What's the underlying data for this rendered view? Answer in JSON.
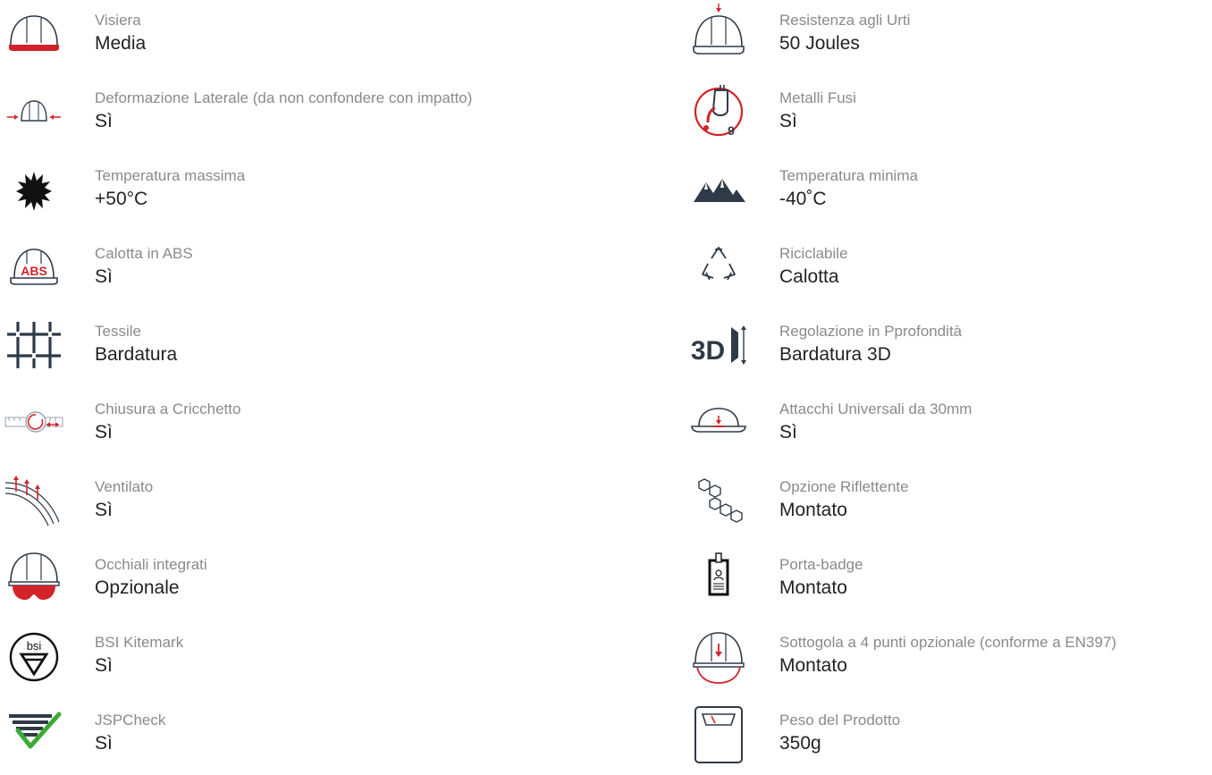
{
  "colors": {
    "accent_red": "#d2232a",
    "icon_dark": "#2f3a48",
    "label_gray": "#8a8a8a",
    "value_dark": "#222222",
    "check_green": "#3aa935"
  },
  "left": [
    {
      "label": "Visiera",
      "value": "Media",
      "icon": "visor-helmet-icon"
    },
    {
      "label": "Deformazione Laterale (da non confondere con impatto)",
      "value": "Sì",
      "icon": "lateral-deformation-icon"
    },
    {
      "label": "Temperatura massima",
      "value": "+50°C",
      "icon": "sun-icon"
    },
    {
      "label": "Calotta in ABS",
      "value": "Sì",
      "icon": "abs-helmet-icon",
      "icon_text": "ABS"
    },
    {
      "label": "Tessile",
      "value": "Bardatura",
      "icon": "textile-grid-icon"
    },
    {
      "label": "Chiusura a Cricchetto",
      "value": "Sì",
      "icon": "ratchet-icon"
    },
    {
      "label": "Ventilato",
      "value": "Sì",
      "icon": "ventilation-icon"
    },
    {
      "label": "Occhiali integrati",
      "value": "Opzionale",
      "icon": "goggles-helmet-icon"
    },
    {
      "label": "BSI Kitemark",
      "value": "Sì",
      "icon": "bsi-kitemark-icon",
      "icon_text": "bsi"
    },
    {
      "label": "JSPCheck",
      "value": "Sì",
      "icon": "jspcheck-icon"
    }
  ],
  "right": [
    {
      "label": "Resistenza agli Urti",
      "value": "50 Joules",
      "icon": "impact-helmet-icon"
    },
    {
      "label": "Metalli Fusi",
      "value": "Sì",
      "icon": "molten-metal-icon",
      "icon_text": "9"
    },
    {
      "label": "Temperatura minima",
      "value": "-40˚C",
      "icon": "mountains-icon"
    },
    {
      "label": "Riciclabile",
      "value": "Calotta",
      "icon": "recycle-icon"
    },
    {
      "label": "Regolazione in Pprofondità",
      "value": "Bardatura 3D",
      "icon": "depth-3d-icon",
      "icon_text": "3D"
    },
    {
      "label": "Attacchi Universali da 30mm",
      "value": "Sì",
      "icon": "universal-slot-icon"
    },
    {
      "label": "Opzione Riflettente",
      "value": "Montato",
      "icon": "reflective-hexagon-icon"
    },
    {
      "label": "Porta-badge",
      "value": "Montato",
      "icon": "badge-holder-icon"
    },
    {
      "label": "Sottogola a 4 punti opzionale (conforme a EN397)",
      "value": "Montato",
      "icon": "chinstrap-helmet-icon"
    },
    {
      "label": "Peso del Prodotto",
      "value": "350g",
      "icon": "scale-icon"
    }
  ]
}
